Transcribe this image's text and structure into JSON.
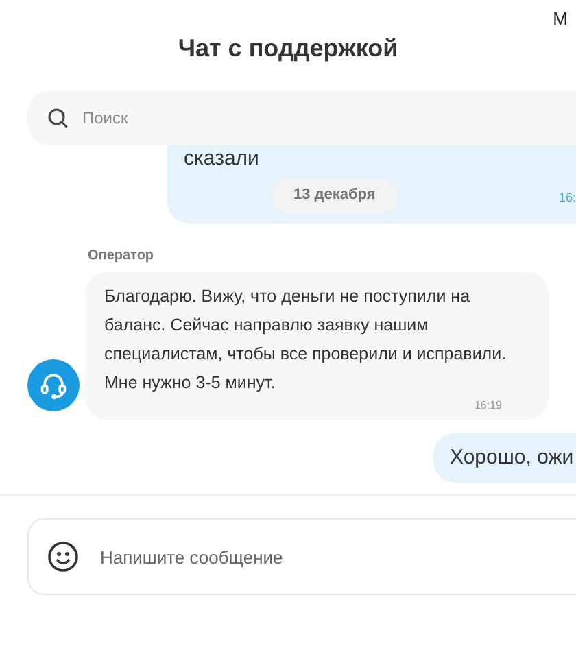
{
  "corner_text": "M",
  "title": "Чат с поддержкой",
  "search": {
    "placeholder": "Поиск"
  },
  "messages": [
    {
      "kind": "user",
      "text": "сказали",
      "time": "16:",
      "date_chip": "13 декабря"
    },
    {
      "kind": "operator",
      "sender": "Оператор",
      "text": "Благодарю. Вижу, что деньги не поступили на баланс. Сейчас направлю заявку нашим специалистам, чтобы все проверили и исправили. Мне нужно 3-5 минут.",
      "time": "16:19"
    },
    {
      "kind": "user",
      "text": "Хорошо, ожи"
    }
  ],
  "composer": {
    "placeholder": "Напишите сообщение"
  }
}
